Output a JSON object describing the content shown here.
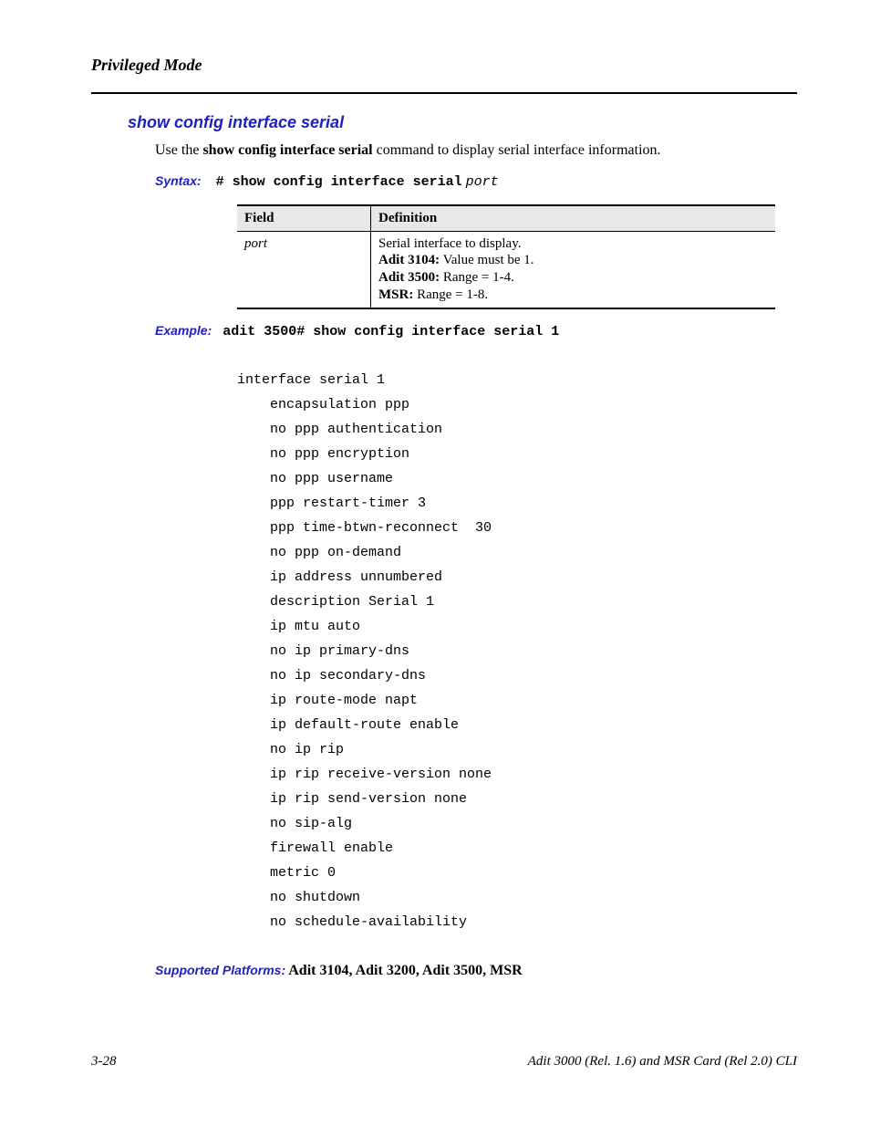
{
  "header": {
    "title": "Privileged Mode"
  },
  "section": {
    "title": "show config interface serial"
  },
  "intro": {
    "prefix": "Use the ",
    "cmd": "show config interface serial",
    "suffix": " command to display serial interface information."
  },
  "syntax": {
    "label": "Syntax:",
    "prompt": "# ",
    "cmd": "show config interface serial",
    "arg": "port"
  },
  "table": {
    "head_field": "Field",
    "head_def": "Definition",
    "row_field": "port",
    "def_line1": "Serial interface to display.",
    "def_l2a": "Adit 3104:",
    "def_l2b": "  Value must be 1.",
    "def_l3a": "Adit 3500:",
    "def_l3b": "  Range = 1-4.",
    "def_l4a": "MSR:",
    "def_l4b": "  Range = 1-8."
  },
  "example": {
    "label": "Example:",
    "cmd": "adit 3500# show config interface serial 1"
  },
  "output": "interface serial 1\n    encapsulation ppp\n    no ppp authentication\n    no ppp encryption\n    no ppp username\n    ppp restart-timer 3\n    ppp time-btwn-reconnect  30\n    no ppp on-demand\n    ip address unnumbered\n    description Serial 1\n    ip mtu auto\n    no ip primary-dns\n    no ip secondary-dns\n    ip route-mode napt\n    ip default-route enable\n    no ip rip\n    ip rip receive-version none\n    ip rip send-version none\n    no sip-alg\n    firewall enable\n    metric 0\n    no shutdown\n    no schedule-availability",
  "supported": {
    "label": "Supported Platforms:",
    "text": "  Adit 3104, Adit 3200, Adit 3500, MSR"
  },
  "footer": {
    "left": "3-28",
    "right": "Adit 3000 (Rel. 1.6) and MSR Card (Rel 2.0) CLI"
  }
}
